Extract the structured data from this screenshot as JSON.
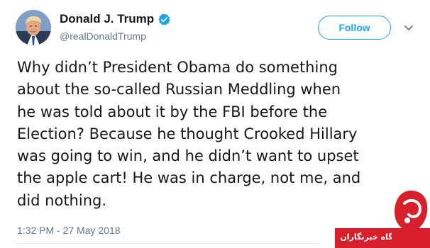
{
  "tweet": {
    "author": {
      "display_name": "Donald J. Trump",
      "handle": "@realDonaldTrump",
      "verified": true,
      "avatar_icon": "avatar-photo-icon"
    },
    "actions": {
      "follow_label": "Follow",
      "menu_icon": "chevron-down-icon"
    },
    "text_lines": [
      "Why didn’t President Obama do something",
      "about the so-called Russian Meddling when",
      "he was told about it by the FBI before the",
      "Election? Because he thought Crooked Hillary",
      "was going to win, and he didn’t want to upset",
      "the apple cart! He was in charge, not me, and",
      "did nothing."
    ],
    "timestamp": "1:32 PM - 27 May 2018"
  },
  "watermark": {
    "label": "باشگاه خبرنگاران"
  },
  "colors": {
    "accent": "#1da1f2",
    "text": "#14171a",
    "muted": "#657786",
    "watermark_red": "#d8202d"
  }
}
